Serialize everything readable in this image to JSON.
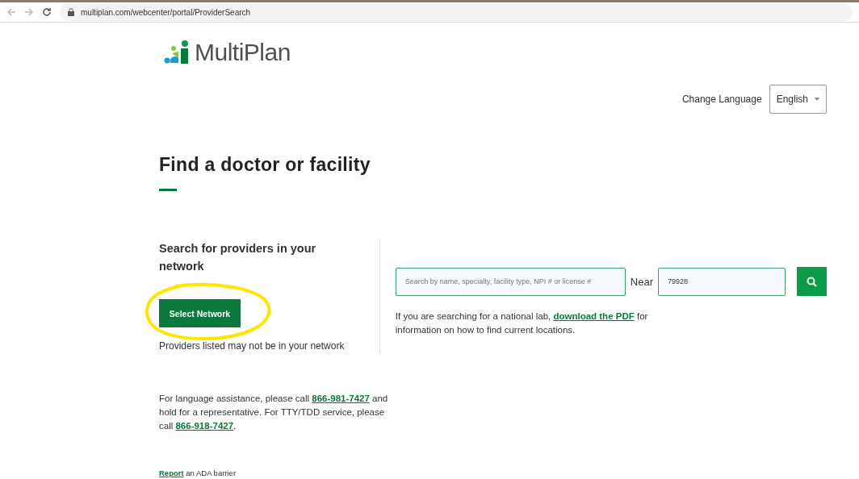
{
  "browser": {
    "url": "multiplan.com/webcenter/portal/ProviderSearch"
  },
  "logo": {
    "text": "MultiPlan"
  },
  "language": {
    "label": "Change Language",
    "value": "English"
  },
  "heading": "Find a doctor or facility",
  "network": {
    "title": "Search for providers in your network",
    "button": "Select Network",
    "note": "Providers listed may not be in your network"
  },
  "search": {
    "placeholder": "Search by name, specialty, facility type, NPI # or license #",
    "near_label": "Near",
    "location": "79928"
  },
  "lab_note": [
    {
      "kind": "text",
      "text": "If you are searching for a national lab, "
    },
    {
      "kind": "link",
      "text": "download the PDF"
    },
    {
      "kind": "text",
      "text": " for information on how to find current locations."
    }
  ],
  "assistance": [
    {
      "kind": "text",
      "text": "For language assistance, please call "
    },
    {
      "kind": "link",
      "text": "866-981-7427"
    },
    {
      "kind": "text",
      "text": " and hold for a representative. For TTY/TDD service, please call "
    },
    {
      "kind": "link",
      "text": "866-918-7427"
    },
    {
      "kind": "text",
      "text": "."
    }
  ],
  "ada": [
    {
      "kind": "link",
      "text": "Report"
    },
    {
      "kind": "text",
      "text": " an ADA barrier"
    }
  ]
}
